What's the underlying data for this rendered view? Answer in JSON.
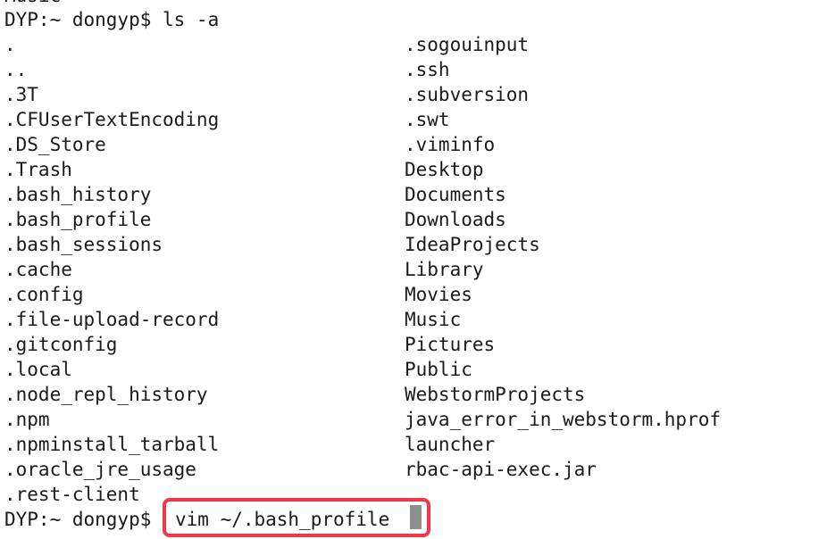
{
  "terminal": {
    "clipped_top_line": "Music",
    "prompt_line": "DYP:~ dongyp$ ls -a",
    "command_prompt": "DYP:~ dongyp$ ",
    "command_text": "vim ~/.bash_profile",
    "cursor": "block-cursor",
    "colors": {
      "background": "#ffffff",
      "foreground": "#1a1a1a",
      "highlight_border": "#f2374a",
      "cursor": "#8e8e8e"
    },
    "listing": {
      "command": "ls -a",
      "left_column": [
        ".",
        "..",
        ".3T",
        ".CFUserTextEncoding",
        ".DS_Store",
        ".Trash",
        ".bash_history",
        ".bash_profile",
        ".bash_sessions",
        ".cache",
        ".config",
        ".file-upload-record",
        ".gitconfig",
        ".local",
        ".node_repl_history",
        ".npm",
        ".npminstall_tarball",
        ".oracle_jre_usage",
        ".rest-client"
      ],
      "right_column": [
        ".sogouinput",
        ".ssh",
        ".subversion",
        ".swt",
        ".viminfo",
        "Desktop",
        "Documents",
        "Downloads",
        "IdeaProjects",
        "Library",
        "Movies",
        "Music",
        "Pictures",
        "Public",
        "WebstormProjects",
        "java_error_in_webstorm.hprof",
        "launcher",
        "rbac-api-exec.jar"
      ]
    }
  }
}
